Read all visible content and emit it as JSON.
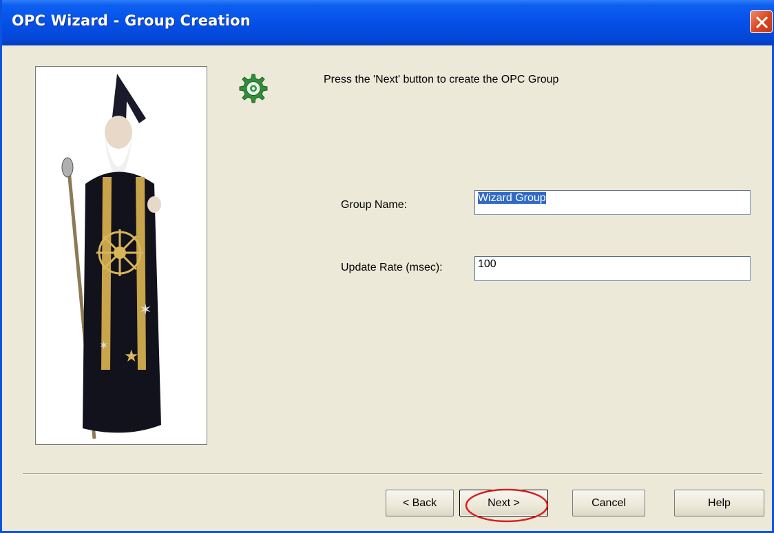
{
  "window": {
    "title": "OPC Wizard - Group Creation",
    "close_icon": "close-icon"
  },
  "content": {
    "instruction": "Press the 'Next' button to create the OPC Group",
    "illustration_icon": "wizard-figure",
    "gear_icon": "gear-icon"
  },
  "form": {
    "group_name": {
      "label": "Group Name:",
      "value": "Wizard Group",
      "selected": true
    },
    "update_rate": {
      "label": "Update Rate (msec):",
      "value": "100"
    }
  },
  "buttons": {
    "back": "< Back",
    "next": "Next >",
    "cancel": "Cancel",
    "help": "Help"
  },
  "colors": {
    "titlebar": "#0550e8",
    "dialog_bg": "#ece9d8",
    "selection": "#316ac5",
    "annotation_oval": "#d81e1e"
  }
}
